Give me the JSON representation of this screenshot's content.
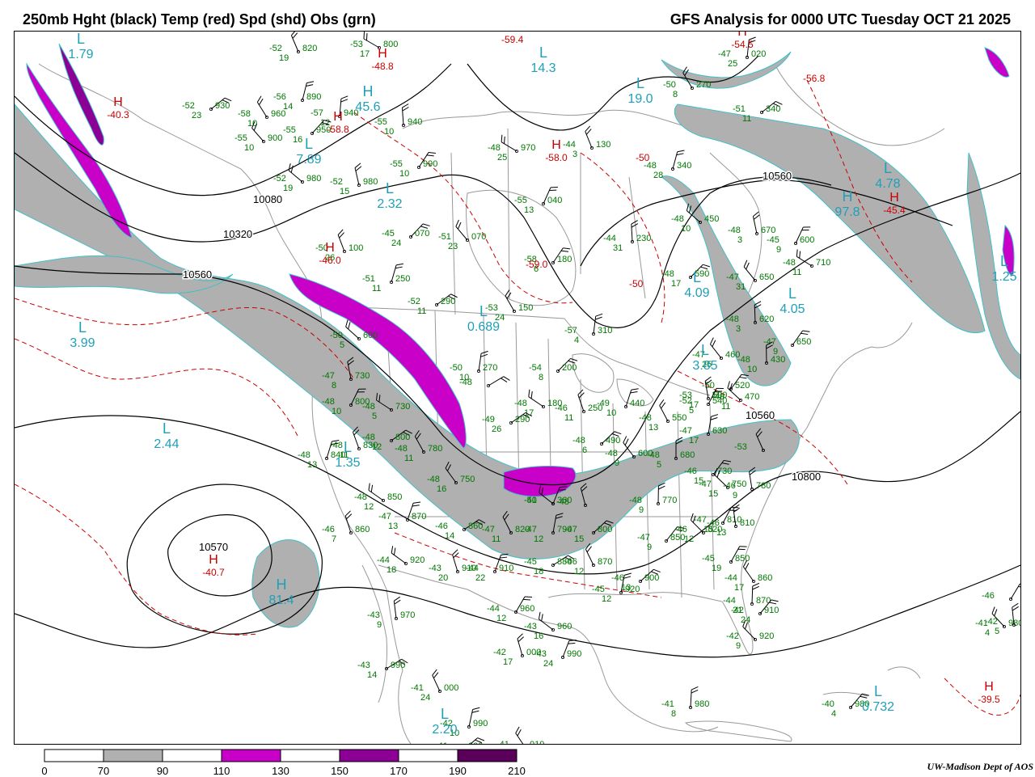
{
  "header": {
    "title_left": "250mb Hght (black) Temp (red) Spd (shd) Obs (grn)",
    "title_right": "GFS Analysis for 0000 UTC Tuesday  OCT 21 2025"
  },
  "colors": {
    "height_contour": "#000000",
    "temperature_contour": "#cc0000",
    "observation": "#007700",
    "pressure_center": "#1fa0b8",
    "speed_70_90": "#b0b0b0",
    "speed_110_130": "#c800c8",
    "speed_150_170": "#8c0096",
    "speed_190_210": "#5a005a",
    "geography": "#999999"
  },
  "colorbar": {
    "ticks": [
      "0",
      "70",
      "90",
      "110",
      "130",
      "150",
      "170",
      "190",
      "210"
    ],
    "colors": [
      "#ffffff",
      "#b0b0b0",
      "#ffffff",
      "#c800c8",
      "#ffffff",
      "#8c0096",
      "#ffffff",
      "#5a005a"
    ]
  },
  "height_labels": [
    {
      "text": "10080"
    },
    {
      "text": "10320"
    },
    {
      "text": "10560"
    },
    {
      "text": "10560"
    },
    {
      "text": "10560"
    },
    {
      "text": "10800"
    },
    {
      "text": "10570"
    }
  ],
  "centers": [
    {
      "letter": "L",
      "value": "1.79"
    },
    {
      "letter": "H",
      "value": "45.6"
    },
    {
      "letter": "L",
      "value": "7.89"
    },
    {
      "letter": "L",
      "value": "2.32"
    },
    {
      "letter": "L",
      "value": "19.0"
    },
    {
      "letter": "L",
      "value": "4.78"
    },
    {
      "letter": "H",
      "value": "97.8"
    },
    {
      "letter": "L",
      "value": "3.99"
    },
    {
      "letter": "L",
      "value": "2.44"
    },
    {
      "letter": "L",
      "value": "1.35"
    },
    {
      "letter": "H",
      "value": "81.4"
    },
    {
      "letter": "L",
      "value": "0.732"
    },
    {
      "letter": "L",
      "value": "2.20"
    },
    {
      "letter": "L",
      "value": "4.05"
    },
    {
      "letter": "L",
      "value": "3.85"
    },
    {
      "letter": "L",
      "value": "0.689"
    },
    {
      "letter": "L",
      "value": "14.3"
    },
    {
      "letter": "L",
      "value": "4.09"
    },
    {
      "letter": "L",
      "value": "1.25"
    }
  ],
  "temp_centers": [
    {
      "letter": "H",
      "value": "-40.3"
    },
    {
      "letter": "H",
      "value": "-48.8"
    },
    {
      "letter": "H",
      "value": "-45.4"
    },
    {
      "letter": "H",
      "value": "-40.7"
    },
    {
      "letter": "H",
      "value": "-39.5"
    },
    {
      "letter": "H",
      "value": "-58.8"
    },
    {
      "letter": "H",
      "value": "-58.0"
    },
    {
      "letter": "H",
      "value": "-54.5"
    },
    {
      "letter": "H",
      "value": "-46.0"
    }
  ],
  "temp_labels": [
    "-56.8",
    "-59.0",
    "-50",
    "-50",
    "-59.4"
  ],
  "observations": [
    {
      "t": "-53",
      "h": "800",
      "s": "17"
    },
    {
      "t": "-52",
      "h": "820",
      "s": "19"
    },
    {
      "t": "-56",
      "h": "890",
      "s": "14"
    },
    {
      "t": "-52",
      "h": "930",
      "s": "23"
    },
    {
      "t": "-58",
      "h": "960",
      "s": "10"
    },
    {
      "t": "-57",
      "h": "940",
      "s": "12"
    },
    {
      "t": "-55",
      "h": "950",
      "s": "16"
    },
    {
      "t": "-55",
      "h": "900",
      "s": "10"
    },
    {
      "t": "-55",
      "h": "940",
      "s": "10"
    },
    {
      "t": "-55",
      "h": "990",
      "s": "10"
    },
    {
      "t": "-52",
      "h": "980",
      "s": "19"
    },
    {
      "t": "-52",
      "h": "980",
      "s": "15"
    },
    {
      "t": "-55",
      "h": "040",
      "s": "13"
    },
    {
      "t": "-48",
      "h": "970",
      "s": "25"
    },
    {
      "t": "-44",
      "h": "130",
      "s": "3"
    },
    {
      "t": "-48",
      "h": "340",
      "s": "28"
    },
    {
      "t": "-51",
      "h": "340",
      "s": "11"
    },
    {
      "t": "-50",
      "h": "270",
      "s": "8"
    },
    {
      "t": "-47",
      "h": "020",
      "s": "25"
    },
    {
      "t": "-45",
      "h": "070",
      "s": "24"
    },
    {
      "t": "-51",
      "h": "070",
      "s": "23"
    },
    {
      "t": "-44",
      "h": "230",
      "s": "31"
    },
    {
      "t": "-58",
      "h": "180",
      "s": "6"
    },
    {
      "t": "-48",
      "h": "450",
      "s": "10"
    },
    {
      "t": "-48",
      "h": "670",
      "s": "3"
    },
    {
      "t": "-45",
      "h": "600",
      "s": "9"
    },
    {
      "t": "-48",
      "h": "710",
      "s": "11"
    },
    {
      "t": "-50",
      "h": "100",
      "s": "26"
    },
    {
      "t": "-51",
      "h": "250",
      "s": "11"
    },
    {
      "t": "-52",
      "h": "290",
      "s": "11"
    },
    {
      "t": "-53",
      "h": "150",
      "s": "24"
    },
    {
      "t": "-57",
      "h": "310",
      "s": "4"
    },
    {
      "t": "-48",
      "h": "590",
      "s": "17"
    },
    {
      "t": "-47",
      "h": "650",
      "s": "31"
    },
    {
      "t": "-48",
      "h": "620",
      "s": "3"
    },
    {
      "t": "-47",
      "h": "650",
      "s": "9"
    },
    {
      "t": "-50",
      "h": "600",
      "s": "5"
    },
    {
      "t": "-47",
      "h": "730",
      "s": "8"
    },
    {
      "t": "-48",
      "h": "800",
      "s": "10"
    },
    {
      "t": "-48",
      "h": "730",
      "s": "5"
    },
    {
      "t": "-48",
      "h": "830",
      "s": "11"
    },
    {
      "t": "-48",
      "h": "840",
      "s": "13"
    },
    {
      "t": "-48",
      "h": "800",
      "s": "12"
    },
    {
      "t": "-48",
      "h": "780",
      "s": "11"
    },
    {
      "t": "-50",
      "h": "270",
      "s": "10"
    },
    {
      "t": "-54",
      "h": "200",
      "s": "8"
    },
    {
      "t": "-47",
      "h": "460",
      "s": "25"
    },
    {
      "t": "-48",
      "h": "430",
      "s": "10"
    },
    {
      "t": "-50",
      "h": "520",
      "s": "11"
    },
    {
      "t": "-49",
      "h": "470",
      "s": "11"
    },
    {
      "t": "-53",
      "h": "500",
      "s": "17"
    },
    {
      "t": "-52",
      "h": "540",
      "s": "5"
    },
    {
      "t": "-48",
      "h": "180",
      "s": "17"
    },
    {
      "t": "-46",
      "h": "250",
      "s": "11"
    },
    {
      "t": "-49",
      "h": "440",
      "s": "10"
    },
    {
      "t": "-49",
      "h": "290",
      "s": "26"
    },
    {
      "t": "-48",
      "h": "550",
      "s": "13"
    },
    {
      "t": "-47",
      "h": "630",
      "s": "17"
    },
    {
      "t": "-48",
      "h": "490",
      "s": "6"
    },
    {
      "t": "-48",
      "h": "600",
      "s": "9"
    },
    {
      "t": "-48",
      "h": "680",
      "s": "5"
    },
    {
      "t": "-46",
      "h": "730",
      "s": "15"
    },
    {
      "t": "-47",
      "h": "750",
      "s": "15"
    },
    {
      "t": "-46",
      "h": "780",
      "s": "9"
    },
    {
      "t": "-47",
      "h": "810",
      "s": "15"
    },
    {
      "t": "-48",
      "h": "850",
      "s": "12"
    },
    {
      "t": "-46",
      "h": "860",
      "s": "7"
    },
    {
      "t": "-47",
      "h": "870",
      "s": "13"
    },
    {
      "t": "-46",
      "h": "860",
      "s": "14"
    },
    {
      "t": "-47",
      "h": "820",
      "s": "11"
    },
    {
      "t": "-47",
      "h": "790",
      "s": "12"
    },
    {
      "t": "-47",
      "h": "800",
      "s": "15"
    },
    {
      "t": "-48",
      "h": "750",
      "s": "16"
    },
    {
      "t": "-48",
      "h": "770",
      "s": "9"
    },
    {
      "t": "-47",
      "h": "850",
      "s": "9"
    },
    {
      "t": "-46",
      "h": "820",
      "s": "12"
    },
    {
      "t": "-46",
      "h": "810",
      "s": "13"
    },
    {
      "t": "-45",
      "h": "850",
      "s": "19"
    },
    {
      "t": "-44",
      "h": "920",
      "s": "18"
    },
    {
      "t": "-43",
      "h": "910",
      "s": "20"
    },
    {
      "t": "-44",
      "h": "910",
      "s": "22"
    },
    {
      "t": "-45",
      "h": "880",
      "s": "18"
    },
    {
      "t": "-46",
      "h": "870",
      "s": "12"
    },
    {
      "t": "-45",
      "h": "920",
      "s": "12"
    },
    {
      "t": "-46",
      "h": "900",
      "s": "13"
    },
    {
      "t": "-44",
      "h": "860",
      "s": "17"
    },
    {
      "t": "-44",
      "h": "870",
      "s": "21"
    },
    {
      "t": "-42",
      "h": "910",
      "s": "24"
    },
    {
      "t": "-42",
      "h": "920",
      "s": "9"
    },
    {
      "t": "-43",
      "h": "970",
      "s": "9"
    },
    {
      "t": "-44",
      "h": "960",
      "s": "12"
    },
    {
      "t": "-43",
      "h": "960",
      "s": "16"
    },
    {
      "t": "-42",
      "h": "000",
      "s": "17"
    },
    {
      "t": "-43",
      "h": "990",
      "s": "24"
    },
    {
      "t": "-43",
      "h": "990",
      "s": "14"
    },
    {
      "t": "-41",
      "h": "000",
      "s": "24"
    },
    {
      "t": "-42",
      "h": "990",
      "s": "10"
    },
    {
      "t": "-41",
      "h": "000",
      "s": "10"
    },
    {
      "t": "-41",
      "h": "010",
      "s": "8"
    },
    {
      "t": "-41",
      "h": "980",
      "s": "8"
    },
    {
      "t": "-40",
      "h": "980",
      "s": "4"
    },
    {
      "t": "-41",
      "h": "980",
      "s": "4"
    },
    {
      "t": "-42",
      "h": "",
      "s": "5"
    },
    {
      "t": "-46",
      "h": "",
      "s": ""
    },
    {
      "t": "-50",
      "h": "",
      "s": ""
    },
    {
      "t": "-48",
      "h": "",
      "s": ""
    },
    {
      "t": "-41",
      "h": "360",
      "s": ""
    },
    {
      "t": "-48",
      "h": "",
      "s": ""
    },
    {
      "t": "-53",
      "h": "",
      "s": ""
    },
    {
      "t": "-54",
      "h": "",
      "s": ""
    }
  ],
  "credit": "UW-Madison  Dept of AOS"
}
